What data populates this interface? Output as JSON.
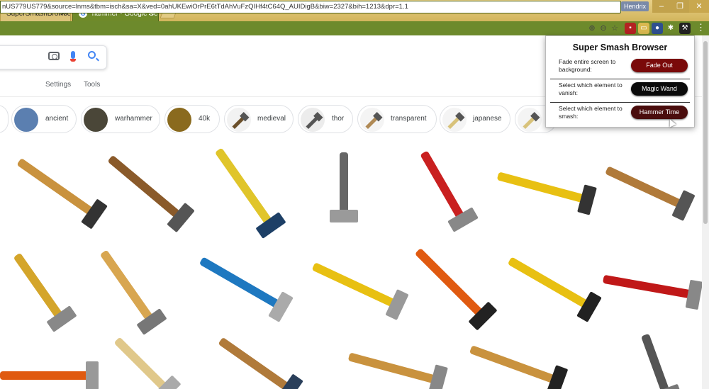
{
  "window": {
    "user_badge": "Hendrix",
    "controls": [
      "–",
      "❐",
      "✕"
    ]
  },
  "tabs": [
    {
      "title": "SuperSmashBrowser - C",
      "close": "✕"
    },
    {
      "title": "hammer - Google Search",
      "close": "✕",
      "favicon": "G"
    }
  ],
  "address_bar": {
    "url": "nUS779US779&source=lnms&tbm=isch&sa=X&ved=0ahUKEwiOrPrE6tTdAhVuFzQIHf4tC64Q_AUIDigB&biw=2327&bih=1213&dpr=1.1"
  },
  "google": {
    "nav": {
      "settings": "Settings",
      "tools": "Tools"
    },
    "chips": [
      "ancient",
      "warhammer",
      "40k",
      "medieval",
      "thor",
      "transparent",
      "japanese"
    ]
  },
  "popup": {
    "title": "Super Smash Browser",
    "rows": [
      {
        "description": "Fade entire screen to background:",
        "button": "Fade Out",
        "color": "#7a0a0a"
      },
      {
        "description": "Select which element to vanish:",
        "button": "Magic Wand",
        "color": "#0a0a0a"
      },
      {
        "description": "Select which element to smash:",
        "button": "Hammer Time",
        "color": "#4a0d0d"
      }
    ]
  },
  "colors": {
    "titlebar": "#d2b55c",
    "toolbar": "#6d8a2c",
    "google_blue": "#4285f4"
  }
}
